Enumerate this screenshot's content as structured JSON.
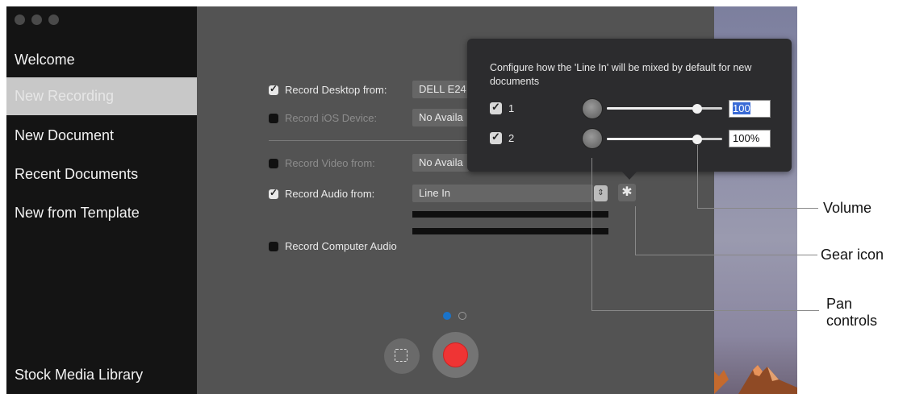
{
  "sidebar": {
    "items": [
      "Welcome",
      "New Recording",
      "New Document",
      "Recent Documents",
      "New from Template"
    ],
    "footer": "Stock Media Library"
  },
  "form": {
    "desktop": {
      "label": "Record Desktop from:",
      "value": "DELL E24",
      "checked": true
    },
    "ios": {
      "label": "Record iOS Device:",
      "value": "No Availa",
      "checked": false
    },
    "video": {
      "label": "Record Video from:",
      "value": "No Availa",
      "checked": false
    },
    "audio": {
      "label": "Record Audio from:",
      "value": "Line In",
      "checked": true
    },
    "computer_audio": {
      "label": "Record Computer Audio",
      "checked": false
    }
  },
  "popover": {
    "title": "Configure how the 'Line In' will be mixed by default for new documents",
    "channels": [
      {
        "label": "1",
        "checked": true,
        "volume_value": "100",
        "volume_fraction": 0.78
      },
      {
        "label": "2",
        "checked": true,
        "volume_value": "100%",
        "volume_fraction": 0.78
      }
    ]
  },
  "pager": {
    "pages": 2,
    "current": 1
  },
  "callouts": {
    "volume": "Volume",
    "gear": "Gear icon",
    "pan": "Pan controls"
  },
  "colors": {
    "record": "#ef3434",
    "pager_active": "#1a73c9"
  }
}
